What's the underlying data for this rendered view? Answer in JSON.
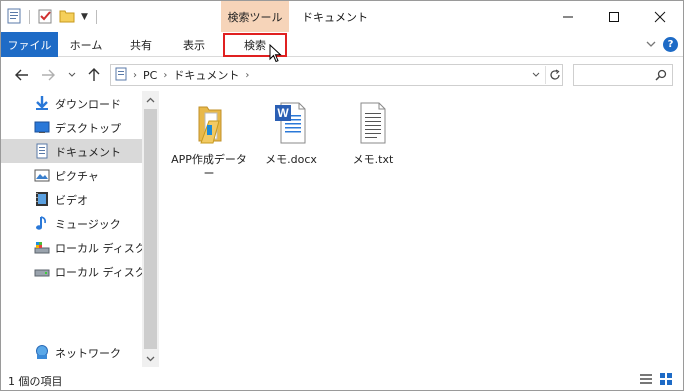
{
  "window": {
    "title": "ドキュメント",
    "context_group": "検索ツール"
  },
  "ribbon": {
    "tabs": [
      {
        "label": "ファイル"
      },
      {
        "label": "ホーム"
      },
      {
        "label": "共有"
      },
      {
        "label": "表示"
      },
      {
        "label": "検索"
      }
    ]
  },
  "address": {
    "breadcrumbs": [
      "PC",
      "ドキュメント"
    ]
  },
  "search": {
    "placeholder": ""
  },
  "nav": {
    "items": [
      {
        "label": "ダウンロード",
        "icon": "download-icon"
      },
      {
        "label": "デスクトップ",
        "icon": "desktop-icon"
      },
      {
        "label": "ドキュメント",
        "icon": "document-icon",
        "selected": true
      },
      {
        "label": "ピクチャ",
        "icon": "pictures-icon"
      },
      {
        "label": "ビデオ",
        "icon": "video-icon"
      },
      {
        "label": "ミュージック",
        "icon": "music-icon"
      },
      {
        "label": "ローカル ディスク (C",
        "icon": "disk-c-icon"
      },
      {
        "label": "ローカル ディスク (D",
        "icon": "disk-d-icon"
      },
      {
        "label": "ネットワーク",
        "icon": "network-icon"
      }
    ]
  },
  "files": [
    {
      "label": "APP作成データー",
      "icon": "folder-icon"
    },
    {
      "label": "メモ.docx",
      "icon": "word-doc-icon"
    },
    {
      "label": "メモ.txt",
      "icon": "text-file-icon"
    }
  ],
  "status": {
    "text": "1 個の項目"
  },
  "colors": {
    "accent": "#1e6bc6",
    "context_tab": "#f6d4b9",
    "highlight_box": "#e02020",
    "selected_nav": "#d9d9d9"
  }
}
